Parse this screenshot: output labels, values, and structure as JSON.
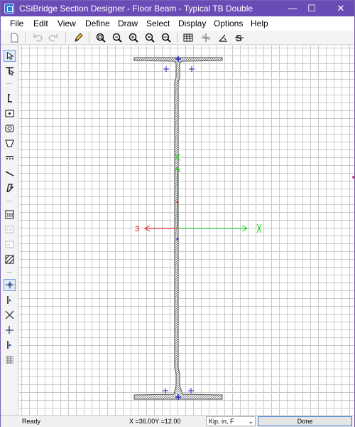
{
  "window": {
    "title": "CSiBridge Section Designer - Floor Beam - Typical TB Double",
    "minimize_glyph": "—",
    "maximize_glyph": "☐",
    "close_glyph": "✕"
  },
  "menu": {
    "file": "File",
    "edit": "Edit",
    "view": "View",
    "define": "Define",
    "draw": "Draw",
    "select": "Select",
    "display": "Display",
    "options": "Options",
    "help": "Help"
  },
  "toolbar_icons": [
    "new-icon",
    "undo-icon",
    "redo-icon",
    "pencil-icon",
    "zoom-window-icon",
    "zoom-restore-icon",
    "zoom-in-icon",
    "zoom-out-icon",
    "zoom-fit-icon",
    "grid-icon",
    "axes-icon",
    "snap-icon",
    "section-properties-icon"
  ],
  "left_tools": [
    "pointer-icon",
    "reshape-icon",
    "draw-i-section-icon",
    "draw-rectangle-icon",
    "draw-circle-icon",
    "draw-polygon-icon",
    "draw-rebar-line-icon",
    "draw-line-icon",
    "draw-tendon-icon",
    "table-icon",
    "point-label-icon",
    "caliper-icon",
    "mesh-icon",
    "snap-intersection-icon",
    "snap-point-icon",
    "snap-perpendicular-icon",
    "snap-midpoint-icon",
    "snap-end-icon",
    "snap-grid-icon"
  ],
  "canvas": {
    "axis_3_label": "3",
    "axis_2_label": "2",
    "axis_3_color": "#e01010",
    "axis_2_color": "#10d010",
    "section_color": "#4a4a4a",
    "point_marker_color": "#2020c0"
  },
  "status": {
    "ready": "Ready",
    "coordinates": "X =36.00Y =12.00",
    "units": "Kip, in, F",
    "done": "Done"
  }
}
